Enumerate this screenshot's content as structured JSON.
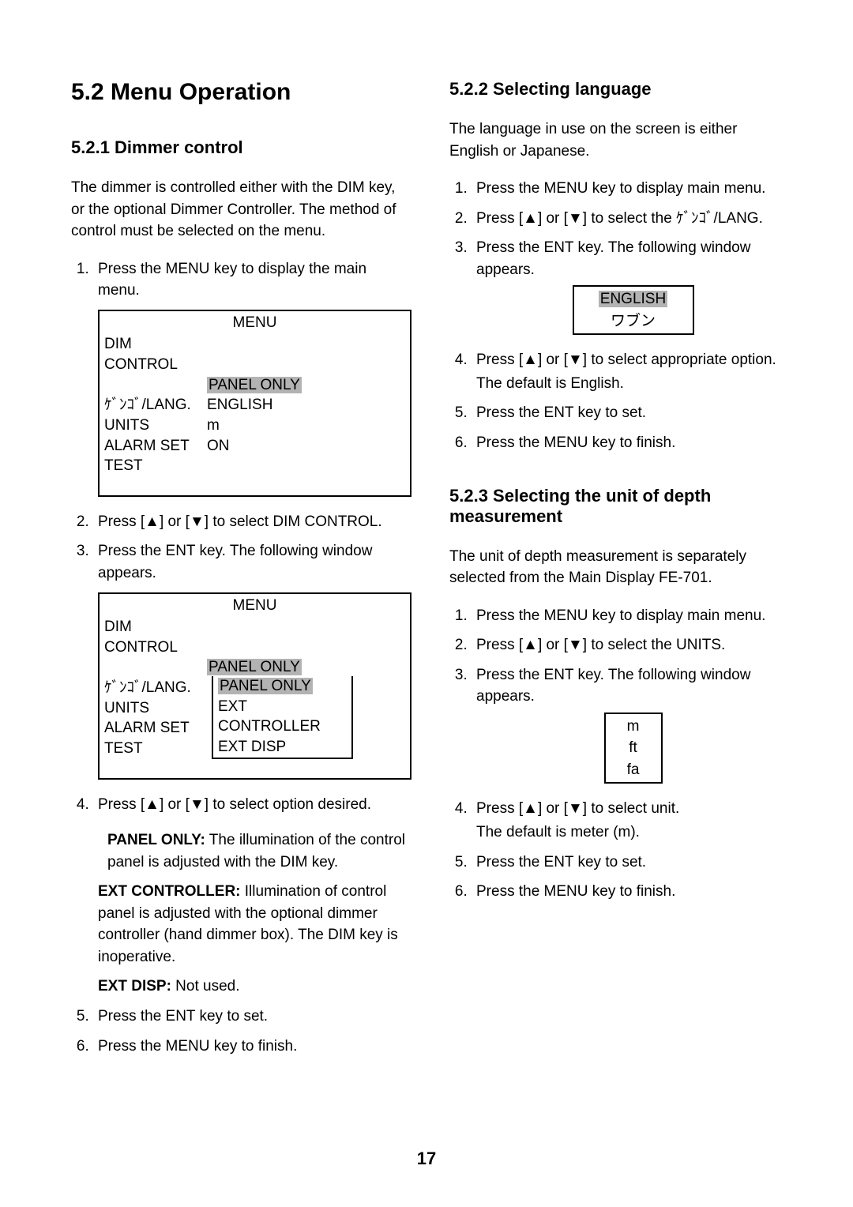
{
  "page_number": "17",
  "glyphs": {
    "up": "▲",
    "down": "▼"
  },
  "left": {
    "section_title": "5.2    Menu Operation",
    "s521": {
      "title": "5.2.1  Dimmer control",
      "intro": "The dimmer is controlled either with the DIM key, or the optional Dimmer Controller. The method of control must be selected on the menu.",
      "step1": "Press the MENU key to display the main menu.",
      "menu1": {
        "title": "MENU",
        "rows": [
          {
            "label": "DIM CONTROL",
            "value": ""
          },
          {
            "label": "",
            "value_hl": "PANEL ONLY"
          },
          {
            "label": "ｹﾞﾝｺﾞ/LANG.",
            "value": "ENGLISH"
          },
          {
            "label": "UNITS",
            "value": "m"
          },
          {
            "label": "ALARM SET",
            "value": "ON"
          },
          {
            "label": "TEST",
            "value": ""
          }
        ]
      },
      "step2_pre": "Press [",
      "step2_mid": "] or [",
      "step2_post": "] to select DIM CONTROL.",
      "step3": "Press the ENT key. The following window appears.",
      "menu2": {
        "title": "MENU",
        "rows_top": [
          {
            "label": "DIM CONTROL",
            "value": ""
          },
          {
            "label": "",
            "value_hl": "PANEL ONLY"
          }
        ],
        "rows_bottom": [
          {
            "label": "ｹﾞﾝｺﾞ/LANG.",
            "value": ""
          },
          {
            "label": "UNITS",
            "value": ""
          },
          {
            "label": "ALARM SET",
            "value": ""
          },
          {
            "label": "TEST",
            "value": ""
          }
        ],
        "dropdown": {
          "opt1_hl": "PANEL ONLY",
          "opt2": "EXT CONTROLLER",
          "opt3": "EXT DISP"
        }
      },
      "step4_pre": "Press [",
      "step4_mid": "] or [",
      "step4_post": "] to select option desired.",
      "panel_only_lead": "PANEL ONLY:",
      "panel_only_text": " The illumination of the control panel is adjusted with the DIM key.",
      "ext_ctrl_lead": "EXT CONTROLLER:",
      "ext_ctrl_text": " Illumination of control panel is adjusted with the optional dimmer controller (hand dimmer box). The DIM key is inoperative.",
      "ext_disp_lead": "EXT DISP:",
      "ext_disp_text": " Not used.",
      "step5": " Press the ENT key to set.",
      "step6": "Press the MENU key to finish."
    }
  },
  "right": {
    "s522": {
      "title": "5.2.2  Selecting language",
      "intro": "The language in use on the screen is either English or Japanese.",
      "step1": "Press the MENU key to display main menu.",
      "step2_pre": "Press [",
      "step2_mid": "] or [",
      "step2_post": "] to select the  ｹﾞﾝｺﾞ/LANG.",
      "step3": "Press the ENT key. The following window appears.",
      "popup": {
        "opt1_hl": "ENGLISH",
        "opt2": "ワブン"
      },
      "step4_pre": "Press [",
      "step4_mid": "] or [",
      "step4_post": "] to select appropriate option.",
      "step4_sub": "The default is English.",
      "step5": "Press the ENT key to set.",
      "step6": "Press the MENU key to finish."
    },
    "s523": {
      "title": "5.2.3  Selecting the unit of depth measurement",
      "intro": "The unit of depth measurement is separately selected from the Main Display FE-701.",
      "step1": "Press the MENU key to display main menu.",
      "step2_pre": "Press [",
      "step2_mid": "] or [",
      "step2_post": "] to select the UNITS.",
      "step3": "Press the ENT key. The following window appears.",
      "popup": {
        "opt1": "m",
        "opt2": "ft",
        "opt3": "fa"
      },
      "step4_pre": "Press [",
      "step4_mid": "] or [",
      "step4_post": "] to select unit.",
      "step4_sub": "The default is meter (m).",
      "step5": "Press the ENT key to set.",
      "step6": "Press the MENU key to finish."
    }
  }
}
